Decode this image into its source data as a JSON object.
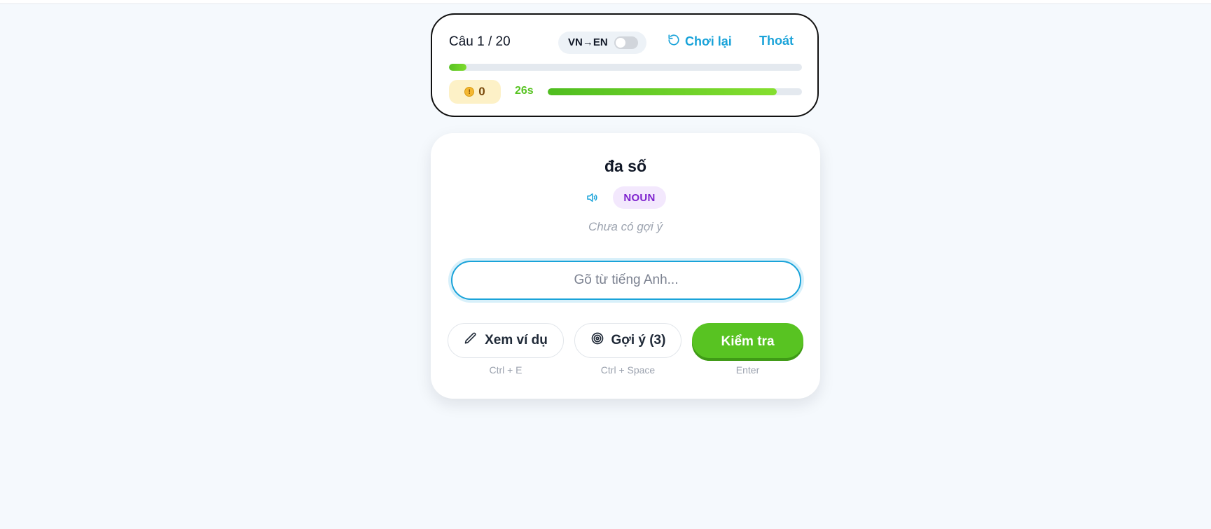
{
  "header": {
    "question_counter": "Câu 1 / 20",
    "direction_label": "VN→EN",
    "direction_toggle_on": false,
    "replay_label": "Chơi lại",
    "exit_label": "Thoát",
    "progress_fraction": 0.05,
    "coins": "0",
    "timer_label": "26s",
    "timer_fraction": 0.9
  },
  "question": {
    "word": "đa số",
    "part_of_speech": "NOUN",
    "hint_text": "Chưa có gợi ý",
    "input_placeholder": "Gõ từ tiếng Anh...",
    "input_value": ""
  },
  "actions": {
    "example_label": "Xem ví dụ",
    "example_shortcut": "Ctrl + E",
    "hint_label": "Gợi ý (3)",
    "hint_shortcut": "Ctrl + Space",
    "check_label": "Kiểm tra",
    "check_shortcut": "Enter"
  },
  "colors": {
    "accent_blue": "#1aa3d9",
    "success_green": "#58c322",
    "pos_purple": "#7e22ce"
  },
  "icons": {
    "replay": "rotate-ccw-icon",
    "coin": "coin-icon",
    "speaker": "speaker-icon",
    "example": "pencil-icon",
    "hint": "target-icon"
  }
}
